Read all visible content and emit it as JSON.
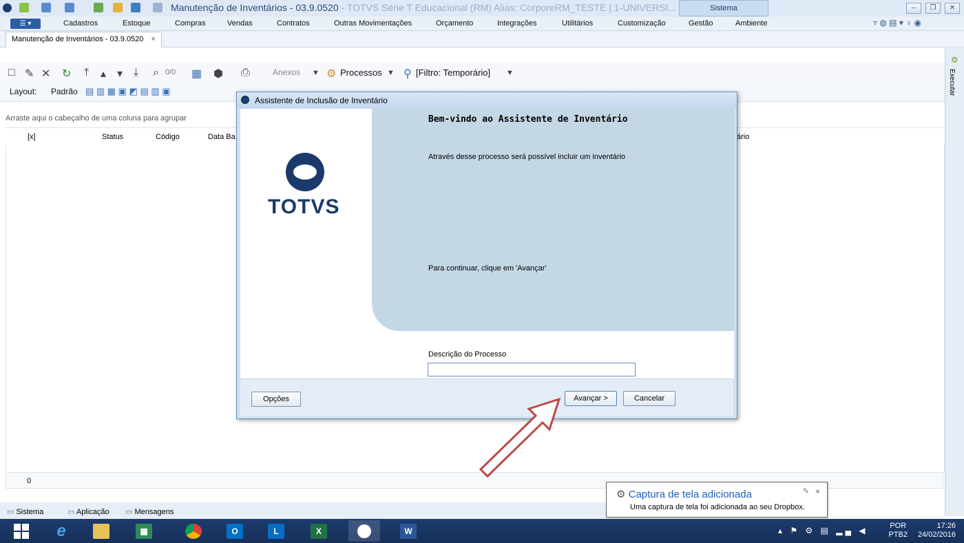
{
  "window": {
    "title_main": "Manutenção de Inventários - 03.9.0520",
    "title_rest": " - TOTVS Série T Educacional (RM) Alias: CorporeRM_TESTE | 1-UNIVERSI...",
    "context_tab": "Sistema"
  },
  "menu": {
    "app_button": "☰ ▾",
    "items": [
      "Cadastros",
      "Estoque",
      "Compras",
      "Vendas",
      "Contratos",
      "Outras Movimentações",
      "Orçamento",
      "Integrações",
      "Utilitários",
      "Customização",
      "Gestão",
      "Ambiente"
    ]
  },
  "doc_tab": {
    "label": "Manutenção de Inventários - 03.9.0520",
    "close": "×"
  },
  "toolbar": {
    "counter": "0/0",
    "anexos": "Anexos",
    "processos": "Processos",
    "filtro": "[Filtro: Temporário]"
  },
  "layoutbar": {
    "label": "Layout:",
    "padrao": "Padrão"
  },
  "grid": {
    "group_hint": "Arraste aqui o cabeçalho de uma coluna para agrupar",
    "columns": [
      "[x]",
      "Status",
      "Código",
      "Data Ba",
      "ário"
    ],
    "footer_count": "0"
  },
  "right_strip": {
    "label": "Executar"
  },
  "status_tabs": [
    "Sistema",
    "Aplicação",
    "Mensagens"
  ],
  "dialog": {
    "title": "Assistente de Inclusão de Inventário",
    "logo_text": "TOTVS",
    "heading": "Bem-vindo ao Assistente de Inventário",
    "body": "Através desse processo será possível incluir um inventário",
    "continue": "Para continuar, clique em 'Avançar'",
    "desc_label": "Descrição do Processo",
    "desc_value": "",
    "btn_options": "Opções",
    "btn_next": "Avançar >",
    "btn_cancel": "Cancelar"
  },
  "toast": {
    "title": "Captura de tela adicionada",
    "message": "Uma captura de tela foi adicionada ao seu Dropbox.",
    "close": "×"
  },
  "taskbar": {
    "lang1": "POR",
    "lang2": "PTB2",
    "time": "17:26",
    "date": "24/02/2016"
  },
  "colors": {
    "accent": "#2d5da5",
    "arrow": "#b94a48",
    "taskbar": "#1d3b6e"
  }
}
